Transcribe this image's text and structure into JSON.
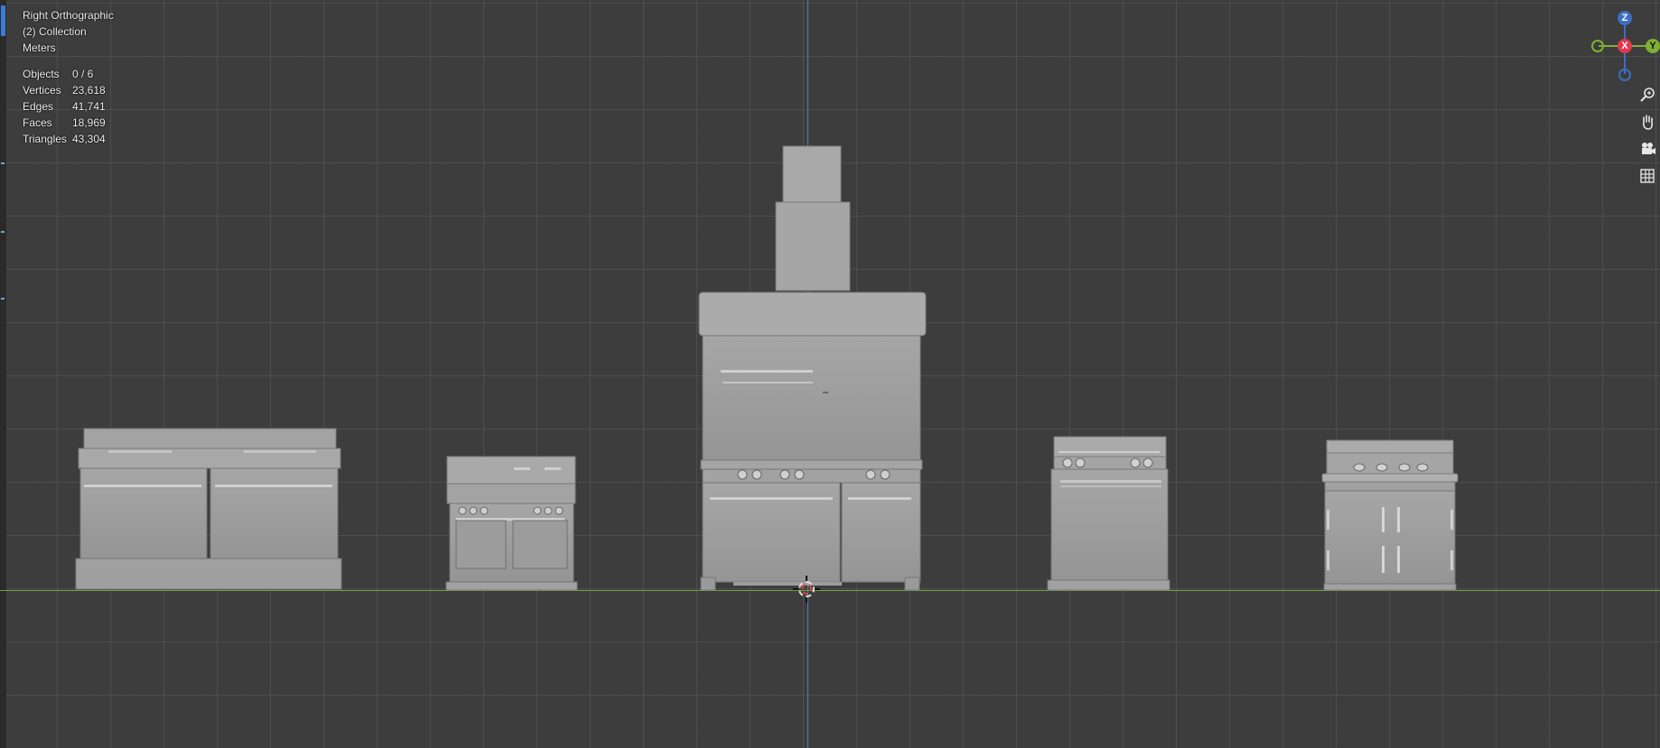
{
  "viewport": {
    "view_name": "Right Orthographic",
    "collection": "(2) Collection",
    "units": "Meters",
    "stats": [
      {
        "label": "Objects",
        "value": "0 / 6"
      },
      {
        "label": "Vertices",
        "value": "23,618"
      },
      {
        "label": "Edges",
        "value": "41,741"
      },
      {
        "label": "Faces",
        "value": "18,969"
      },
      {
        "label": "Triangles",
        "value": "43,304"
      }
    ]
  },
  "gizmo": {
    "z_label": "Z",
    "x_label": "X",
    "y_label": "Y",
    "colors": {
      "z": "#3c6fc4",
      "x": "#e2384d",
      "y": "#7fb033"
    }
  },
  "nav_buttons": {
    "zoom": "zoom-icon",
    "pan": "hand-pan-icon",
    "camera": "camera-icon",
    "ortho": "grid-icon"
  },
  "colors": {
    "background": "#3d3d3d",
    "grid": "#5a5a5a",
    "axis_z": "#4f7dbd",
    "axis_y": "#7ba23d",
    "objects": "#9c9c9c"
  }
}
